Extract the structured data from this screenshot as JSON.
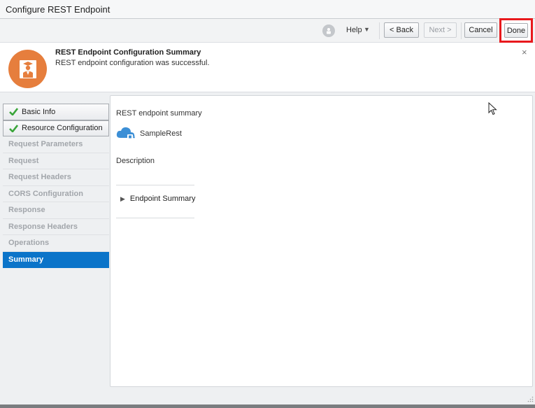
{
  "window": {
    "title": "Configure REST Endpoint"
  },
  "toolbar": {
    "help_icon": "help-badge-icon",
    "help_label": "Help",
    "back_label": "< Back",
    "next_label": "Next >",
    "cancel_label": "Cancel",
    "done_label": "Done"
  },
  "message": {
    "title": "REST Endpoint Configuration Summary",
    "text": "REST endpoint configuration was successful.",
    "icon": "orange-user-badge-icon",
    "close": "×"
  },
  "nav": {
    "items": [
      {
        "label": "Basic Info",
        "state": "completed"
      },
      {
        "label": "Resource Configuration",
        "state": "completed"
      },
      {
        "label": "Request Parameters",
        "state": "disabled"
      },
      {
        "label": "Request",
        "state": "disabled"
      },
      {
        "label": "Request Headers",
        "state": "disabled"
      },
      {
        "label": "CORS Configuration",
        "state": "disabled"
      },
      {
        "label": "Response",
        "state": "disabled"
      },
      {
        "label": "Response Headers",
        "state": "disabled"
      },
      {
        "label": "Operations",
        "state": "disabled"
      },
      {
        "label": "Summary",
        "state": "active"
      }
    ]
  },
  "summary": {
    "heading": "REST endpoint summary",
    "service_name": "SampleRest",
    "service_icon": "cloud-plug-icon",
    "description_label": "Description",
    "endpoint_section": "Endpoint Summary"
  },
  "colors": {
    "accent": "#0b74c9",
    "highlight": "#e8191d",
    "message_icon": "#e67e3d",
    "check": "#3aa53a"
  }
}
